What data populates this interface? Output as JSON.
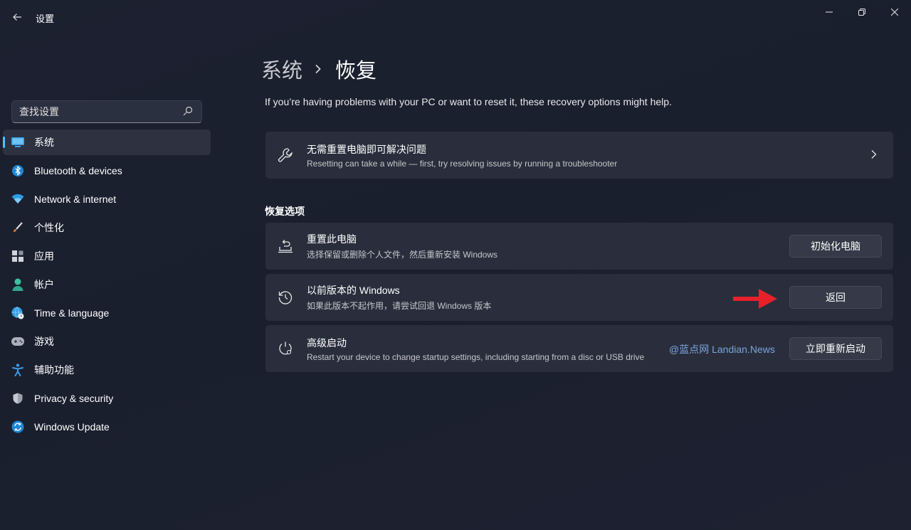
{
  "window": {
    "title": "设置",
    "controls": [
      "minimize",
      "maximize",
      "close"
    ]
  },
  "sidebar": {
    "search_placeholder": "查找设置",
    "items": [
      {
        "label": "系统",
        "icon": "monitor-icon",
        "active": true
      },
      {
        "label": "Bluetooth & devices",
        "icon": "bluetooth-icon",
        "active": false
      },
      {
        "label": "Network & internet",
        "icon": "wifi-icon",
        "active": false
      },
      {
        "label": "个性化",
        "icon": "paintbrush-icon",
        "active": false
      },
      {
        "label": "应用",
        "icon": "apps-icon",
        "active": false
      },
      {
        "label": "帐户",
        "icon": "person-icon",
        "active": false
      },
      {
        "label": "Time & language",
        "icon": "globe-clock-icon",
        "active": false
      },
      {
        "label": "游戏",
        "icon": "gamepad-icon",
        "active": false
      },
      {
        "label": "辅助功能",
        "icon": "accessibility-icon",
        "active": false
      },
      {
        "label": "Privacy & security",
        "icon": "shield-icon",
        "active": false
      },
      {
        "label": "Windows Update",
        "icon": "update-icon",
        "active": false
      }
    ]
  },
  "main": {
    "breadcrumb": {
      "parent": "系统",
      "current": "恢复"
    },
    "intro": "If you’re having problems with your PC or want to reset it, these recovery options might help.",
    "troubleshoot_card": {
      "title": "无需重置电脑即可解决问题",
      "desc": "Resetting can take a while — first, try resolving issues by running a troubleshooter"
    },
    "section_title": "恢复选项",
    "options": [
      {
        "title": "重置此电脑",
        "desc": "选择保留或删除个人文件，然后重新安装 Windows",
        "button": "初始化电脑",
        "icon": "reset-pc-icon"
      },
      {
        "title": "以前版本的 Windows",
        "desc": "如果此版本不起作用，请尝试回退 Windows 版本",
        "button": "返回",
        "icon": "history-icon"
      },
      {
        "title": "高级启动",
        "desc": "Restart your device to change startup settings, including starting from a disc or USB drive",
        "button": "立即重新启动",
        "icon": "advanced-startup-icon"
      }
    ],
    "watermark": "@蓝点网 Landian.News"
  },
  "colors": {
    "accent": "#4cc2ff",
    "annotation_arrow": "#e8202a",
    "card_bg": "#2a2e3c",
    "button_bg": "#363a48"
  }
}
